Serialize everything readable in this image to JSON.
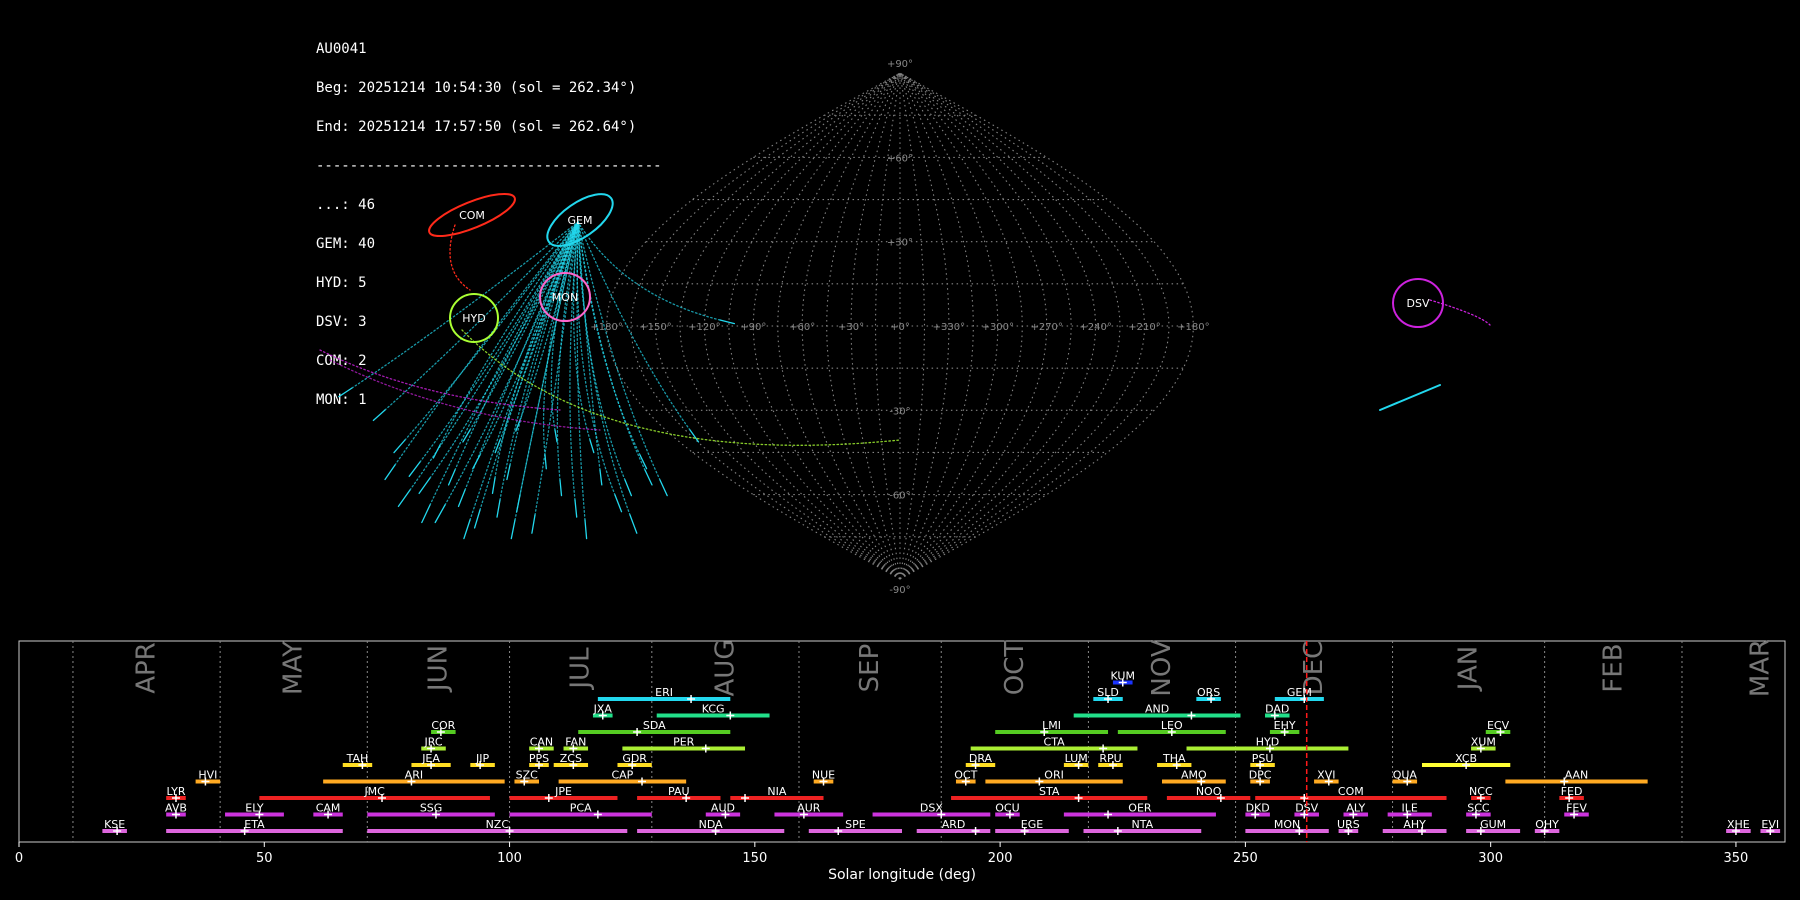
{
  "info": {
    "station": "AU0041",
    "begin": "Beg: 20251214 10:54:30 (sol = 262.34°)",
    "end": "End: 20251214 17:57:50 (sol = 262.64°)",
    "separator": "-----------------------------------------",
    "counts": [
      "...: 46",
      "GEM: 40",
      "HYD: 5",
      "DSV: 3",
      "COM: 2",
      "MON: 1"
    ]
  },
  "sky_map": {
    "projection": "sinusoidal",
    "lon_ticks": [
      "+180°",
      "+150°",
      "+120°",
      "+90°",
      "+60°",
      "+30°",
      "+0°",
      "+330°",
      "+300°",
      "+270°",
      "+240°",
      "+210°",
      "+180°"
    ],
    "lat_ticks": [
      "+90°",
      "+60°",
      "+30°",
      "-30°",
      "-60°",
      "-90°"
    ],
    "radiants": [
      {
        "code": "COM",
        "color": "#ff2a1a"
      },
      {
        "code": "GEM",
        "color": "#22d8ee"
      },
      {
        "code": "MON",
        "color": "#ff66cc"
      },
      {
        "code": "HYD",
        "color": "#aaff33"
      },
      {
        "code": "DSV",
        "color": "#cc22dd"
      }
    ]
  },
  "chart_data": {
    "type": "timeline",
    "xlabel": "Solar longitude (deg)",
    "xlim": [
      0,
      360
    ],
    "x_ticks": [
      0,
      50,
      100,
      150,
      200,
      250,
      300,
      350
    ],
    "month_labels": [
      "APR",
      "MAY",
      "JUN",
      "JUL",
      "AUG",
      "SEP",
      "OCT",
      "NOV",
      "DEC",
      "JAN",
      "FEB",
      "MAR"
    ],
    "month_boundaries": [
      11,
      41,
      71,
      100,
      129,
      159,
      188,
      218,
      248,
      280,
      311,
      339
    ],
    "current_sol": 262.5,
    "showers": [
      {
        "code": "KUM",
        "start": 223,
        "end": 227,
        "peak": 225,
        "row": 9,
        "color": "#1a33ff"
      },
      {
        "code": "ERI",
        "start": 118,
        "end": 145,
        "peak": 137,
        "row": 8,
        "color": "#22d8ee"
      },
      {
        "code": "SLD",
        "start": 219,
        "end": 225,
        "peak": 222,
        "row": 8,
        "color": "#22d8ee"
      },
      {
        "code": "ORS",
        "start": 240,
        "end": 245,
        "peak": 243,
        "row": 8,
        "color": "#22d8ee"
      },
      {
        "code": "GEM",
        "start": 256,
        "end": 266,
        "peak": 262,
        "row": 8,
        "color": "#22d8ee"
      },
      {
        "code": "JXA",
        "start": 117,
        "end": 121,
        "peak": 119,
        "row": 7,
        "color": "#22e08a"
      },
      {
        "code": "KCG",
        "start": 130,
        "end": 153,
        "peak": 145,
        "row": 7,
        "color": "#22e08a"
      },
      {
        "code": "AND",
        "start": 215,
        "end": 249,
        "peak": 239,
        "row": 7,
        "color": "#22e08a"
      },
      {
        "code": "DAD",
        "start": 254,
        "end": 259,
        "peak": 256,
        "row": 7,
        "color": "#22e08a"
      },
      {
        "code": "COR",
        "start": 84,
        "end": 89,
        "peak": 86,
        "row": 6,
        "color": "#55cc22"
      },
      {
        "code": "SDA",
        "start": 114,
        "end": 145,
        "peak": 126,
        "row": 6,
        "color": "#55cc22"
      },
      {
        "code": "LMI",
        "start": 199,
        "end": 222,
        "peak": 209,
        "row": 6,
        "color": "#55cc22"
      },
      {
        "code": "LEO",
        "start": 224,
        "end": 246,
        "peak": 235,
        "row": 6,
        "color": "#55cc22"
      },
      {
        "code": "EHY",
        "start": 255,
        "end": 261,
        "peak": 258,
        "row": 6,
        "color": "#55cc22"
      },
      {
        "code": "ECV",
        "start": 299,
        "end": 304,
        "peak": 302,
        "row": 6,
        "color": "#55cc22"
      },
      {
        "code": "JRC",
        "start": 82,
        "end": 87,
        "peak": 84,
        "row": 5,
        "color": "#aaee33"
      },
      {
        "code": "CAN",
        "start": 104,
        "end": 109,
        "peak": 106,
        "row": 5,
        "color": "#aaee33"
      },
      {
        "code": "FAN",
        "start": 111,
        "end": 116,
        "peak": 113,
        "row": 5,
        "color": "#aaee33"
      },
      {
        "code": "PER",
        "start": 123,
        "end": 148,
        "peak": 140,
        "row": 5,
        "color": "#aaee33"
      },
      {
        "code": "CTA",
        "start": 194,
        "end": 228,
        "peak": 221,
        "row": 5,
        "color": "#aaee33"
      },
      {
        "code": "HYD",
        "start": 238,
        "end": 271,
        "peak": 255,
        "row": 5,
        "color": "#aaee33"
      },
      {
        "code": "XUM",
        "start": 296,
        "end": 301,
        "peak": 298,
        "row": 5,
        "color": "#aaee33"
      },
      {
        "code": "TAH",
        "start": 66,
        "end": 72,
        "peak": 70,
        "row": 4,
        "color": "#ffdd22"
      },
      {
        "code": "JEA",
        "start": 80,
        "end": 88,
        "peak": 84,
        "row": 4,
        "color": "#ffdd22"
      },
      {
        "code": "JIP",
        "start": 92,
        "end": 97,
        "peak": 94,
        "row": 4,
        "color": "#ffdd22"
      },
      {
        "code": "PPS",
        "start": 104,
        "end": 108,
        "peak": 106,
        "row": 4,
        "color": "#ffdd22"
      },
      {
        "code": "ZCS",
        "start": 109,
        "end": 116,
        "peak": 113,
        "row": 4,
        "color": "#ffdd22"
      },
      {
        "code": "GDR",
        "start": 122,
        "end": 129,
        "peak": 125,
        "row": 4,
        "color": "#ffdd22"
      },
      {
        "code": "DRA",
        "start": 193,
        "end": 199,
        "peak": 195,
        "row": 4,
        "color": "#ffdd22"
      },
      {
        "code": "LUM",
        "start": 213,
        "end": 218,
        "peak": 216,
        "row": 4,
        "color": "#ffdd22"
      },
      {
        "code": "RPU",
        "start": 220,
        "end": 225,
        "peak": 223,
        "row": 4,
        "color": "#ffdd22"
      },
      {
        "code": "THA",
        "start": 232,
        "end": 239,
        "peak": 236,
        "row": 4,
        "color": "#ffdd22"
      },
      {
        "code": "PSU",
        "start": 251,
        "end": 256,
        "peak": 253,
        "row": 4,
        "color": "#ffdd22"
      },
      {
        "code": "XCB",
        "start": 286,
        "end": 304,
        "peak": 295,
        "row": 4,
        "color": "#ffff33"
      },
      {
        "code": "HVI",
        "start": 36,
        "end": 41,
        "peak": 38,
        "row": 3,
        "color": "#ffaa22"
      },
      {
        "code": "ARI",
        "start": 62,
        "end": 99,
        "peak": 80,
        "row": 3,
        "color": "#ffaa22"
      },
      {
        "code": "SZC",
        "start": 101,
        "end": 106,
        "peak": 103,
        "row": 3,
        "color": "#ffaa22"
      },
      {
        "code": "CAP",
        "start": 110,
        "end": 136,
        "peak": 127,
        "row": 3,
        "color": "#ffaa22"
      },
      {
        "code": "NUE",
        "start": 162,
        "end": 166,
        "peak": 164,
        "row": 3,
        "color": "#ffaa22"
      },
      {
        "code": "OCT",
        "start": 191,
        "end": 195,
        "peak": 193,
        "row": 3,
        "color": "#ffaa22"
      },
      {
        "code": "ORI",
        "start": 197,
        "end": 225,
        "peak": 208,
        "row": 3,
        "color": "#ffaa22"
      },
      {
        "code": "AMO",
        "start": 233,
        "end": 246,
        "peak": 241,
        "row": 3,
        "color": "#ffaa22"
      },
      {
        "code": "DPC",
        "start": 251,
        "end": 255,
        "peak": 253,
        "row": 3,
        "color": "#ffaa22"
      },
      {
        "code": "XVI",
        "start": 264,
        "end": 269,
        "peak": 267,
        "row": 3,
        "color": "#ffaa22"
      },
      {
        "code": "QUA",
        "start": 280,
        "end": 285,
        "peak": 283,
        "row": 3,
        "color": "#ffaa22"
      },
      {
        "code": "AAN",
        "start": 303,
        "end": 332,
        "peak": 315,
        "row": 3,
        "color": "#ffaa22"
      },
      {
        "code": "LYR",
        "start": 30,
        "end": 34,
        "peak": 32,
        "row": 2,
        "color": "#ee2222"
      },
      {
        "code": "JMC",
        "start": 49,
        "end": 96,
        "peak": 74,
        "row": 2,
        "color": "#ee2222"
      },
      {
        "code": "JPE",
        "start": 100,
        "end": 122,
        "peak": 108,
        "row": 2,
        "color": "#ee2222"
      },
      {
        "code": "PAU",
        "start": 126,
        "end": 143,
        "peak": 136,
        "row": 2,
        "color": "#ee2222"
      },
      {
        "code": "NIA",
        "start": 145,
        "end": 164,
        "peak": 148,
        "row": 2,
        "color": "#ee2222"
      },
      {
        "code": "STA",
        "start": 190,
        "end": 230,
        "peak": 216,
        "row": 2,
        "color": "#ee2222"
      },
      {
        "code": "NOO",
        "start": 234,
        "end": 251,
        "peak": 245,
        "row": 2,
        "color": "#ee2222"
      },
      {
        "code": "COM",
        "start": 252,
        "end": 291,
        "peak": 262,
        "row": 2,
        "color": "#ee2222"
      },
      {
        "code": "NCC",
        "start": 296,
        "end": 300,
        "peak": 298,
        "row": 2,
        "color": "#ee2222"
      },
      {
        "code": "FED",
        "start": 314,
        "end": 319,
        "peak": 316,
        "row": 2,
        "color": "#ee2222"
      },
      {
        "code": "AVB",
        "start": 30,
        "end": 34,
        "peak": 32,
        "row": 1,
        "color": "#cc33dd"
      },
      {
        "code": "ELY",
        "start": 42,
        "end": 54,
        "peak": 49,
        "row": 1,
        "color": "#cc33dd"
      },
      {
        "code": "CAM",
        "start": 60,
        "end": 66,
        "peak": 63,
        "row": 1,
        "color": "#cc33dd"
      },
      {
        "code": "SSG",
        "start": 71,
        "end": 97,
        "peak": 85,
        "row": 1,
        "color": "#cc33dd"
      },
      {
        "code": "PCA",
        "start": 100,
        "end": 129,
        "peak": 118,
        "row": 1,
        "color": "#cc33dd"
      },
      {
        "code": "AUD",
        "start": 140,
        "end": 147,
        "peak": 144,
        "row": 1,
        "color": "#cc33dd"
      },
      {
        "code": "AUR",
        "start": 154,
        "end": 168,
        "peak": 160,
        "row": 1,
        "color": "#cc33dd"
      },
      {
        "code": "DSX",
        "start": 174,
        "end": 198,
        "peak": 188,
        "row": 1,
        "color": "#cc33dd"
      },
      {
        "code": "OCU",
        "start": 199,
        "end": 204,
        "peak": 202,
        "row": 1,
        "color": "#cc33dd"
      },
      {
        "code": "OER",
        "start": 213,
        "end": 244,
        "peak": 222,
        "row": 1,
        "color": "#cc33dd"
      },
      {
        "code": "DKD",
        "start": 250,
        "end": 255,
        "peak": 252,
        "row": 1,
        "color": "#cc33dd"
      },
      {
        "code": "DSV",
        "start": 260,
        "end": 265,
        "peak": 262,
        "row": 1,
        "color": "#cc33dd"
      },
      {
        "code": "ALY",
        "start": 270,
        "end": 275,
        "peak": 272,
        "row": 1,
        "color": "#cc33dd"
      },
      {
        "code": "ILE",
        "start": 279,
        "end": 288,
        "peak": 283,
        "row": 1,
        "color": "#cc33dd"
      },
      {
        "code": "SCC",
        "start": 295,
        "end": 300,
        "peak": 297,
        "row": 1,
        "color": "#cc33dd"
      },
      {
        "code": "FEV",
        "start": 315,
        "end": 320,
        "peak": 317,
        "row": 1,
        "color": "#cc33dd"
      },
      {
        "code": "KSE",
        "start": 17,
        "end": 22,
        "peak": 20,
        "row": 0,
        "color": "#dd66dd"
      },
      {
        "code": "ETA",
        "start": 30,
        "end": 66,
        "peak": 46,
        "row": 0,
        "color": "#dd66dd"
      },
      {
        "code": "NZC",
        "start": 71,
        "end": 124,
        "peak": 100,
        "row": 0,
        "color": "#dd66dd"
      },
      {
        "code": "NDA",
        "start": 126,
        "end": 156,
        "peak": 142,
        "row": 0,
        "color": "#dd66dd"
      },
      {
        "code": "SPE",
        "start": 161,
        "end": 180,
        "peak": 167,
        "row": 0,
        "color": "#dd66dd"
      },
      {
        "code": "ARD",
        "start": 183,
        "end": 198,
        "peak": 195,
        "row": 0,
        "color": "#dd66dd"
      },
      {
        "code": "EGE",
        "start": 199,
        "end": 214,
        "peak": 205,
        "row": 0,
        "color": "#dd66dd"
      },
      {
        "code": "NTA",
        "start": 217,
        "end": 241,
        "peak": 224,
        "row": 0,
        "color": "#dd66dd"
      },
      {
        "code": "MON",
        "start": 250,
        "end": 267,
        "peak": 261,
        "row": 0,
        "color": "#dd66dd"
      },
      {
        "code": "URS",
        "start": 269,
        "end": 273,
        "peak": 271,
        "row": 0,
        "color": "#dd66dd"
      },
      {
        "code": "AHY",
        "start": 278,
        "end": 291,
        "peak": 286,
        "row": 0,
        "color": "#dd66dd"
      },
      {
        "code": "GUM",
        "start": 295,
        "end": 306,
        "peak": 298,
        "row": 0,
        "color": "#dd66dd"
      },
      {
        "code": "OHY",
        "start": 309,
        "end": 314,
        "peak": 311,
        "row": 0,
        "color": "#dd66dd"
      },
      {
        "code": "XHE",
        "start": 348,
        "end": 353,
        "peak": 350,
        "row": 0,
        "color": "#dd66dd"
      },
      {
        "code": "EVI",
        "start": 355,
        "end": 359,
        "peak": 357,
        "row": 0,
        "color": "#dd66dd"
      }
    ]
  }
}
